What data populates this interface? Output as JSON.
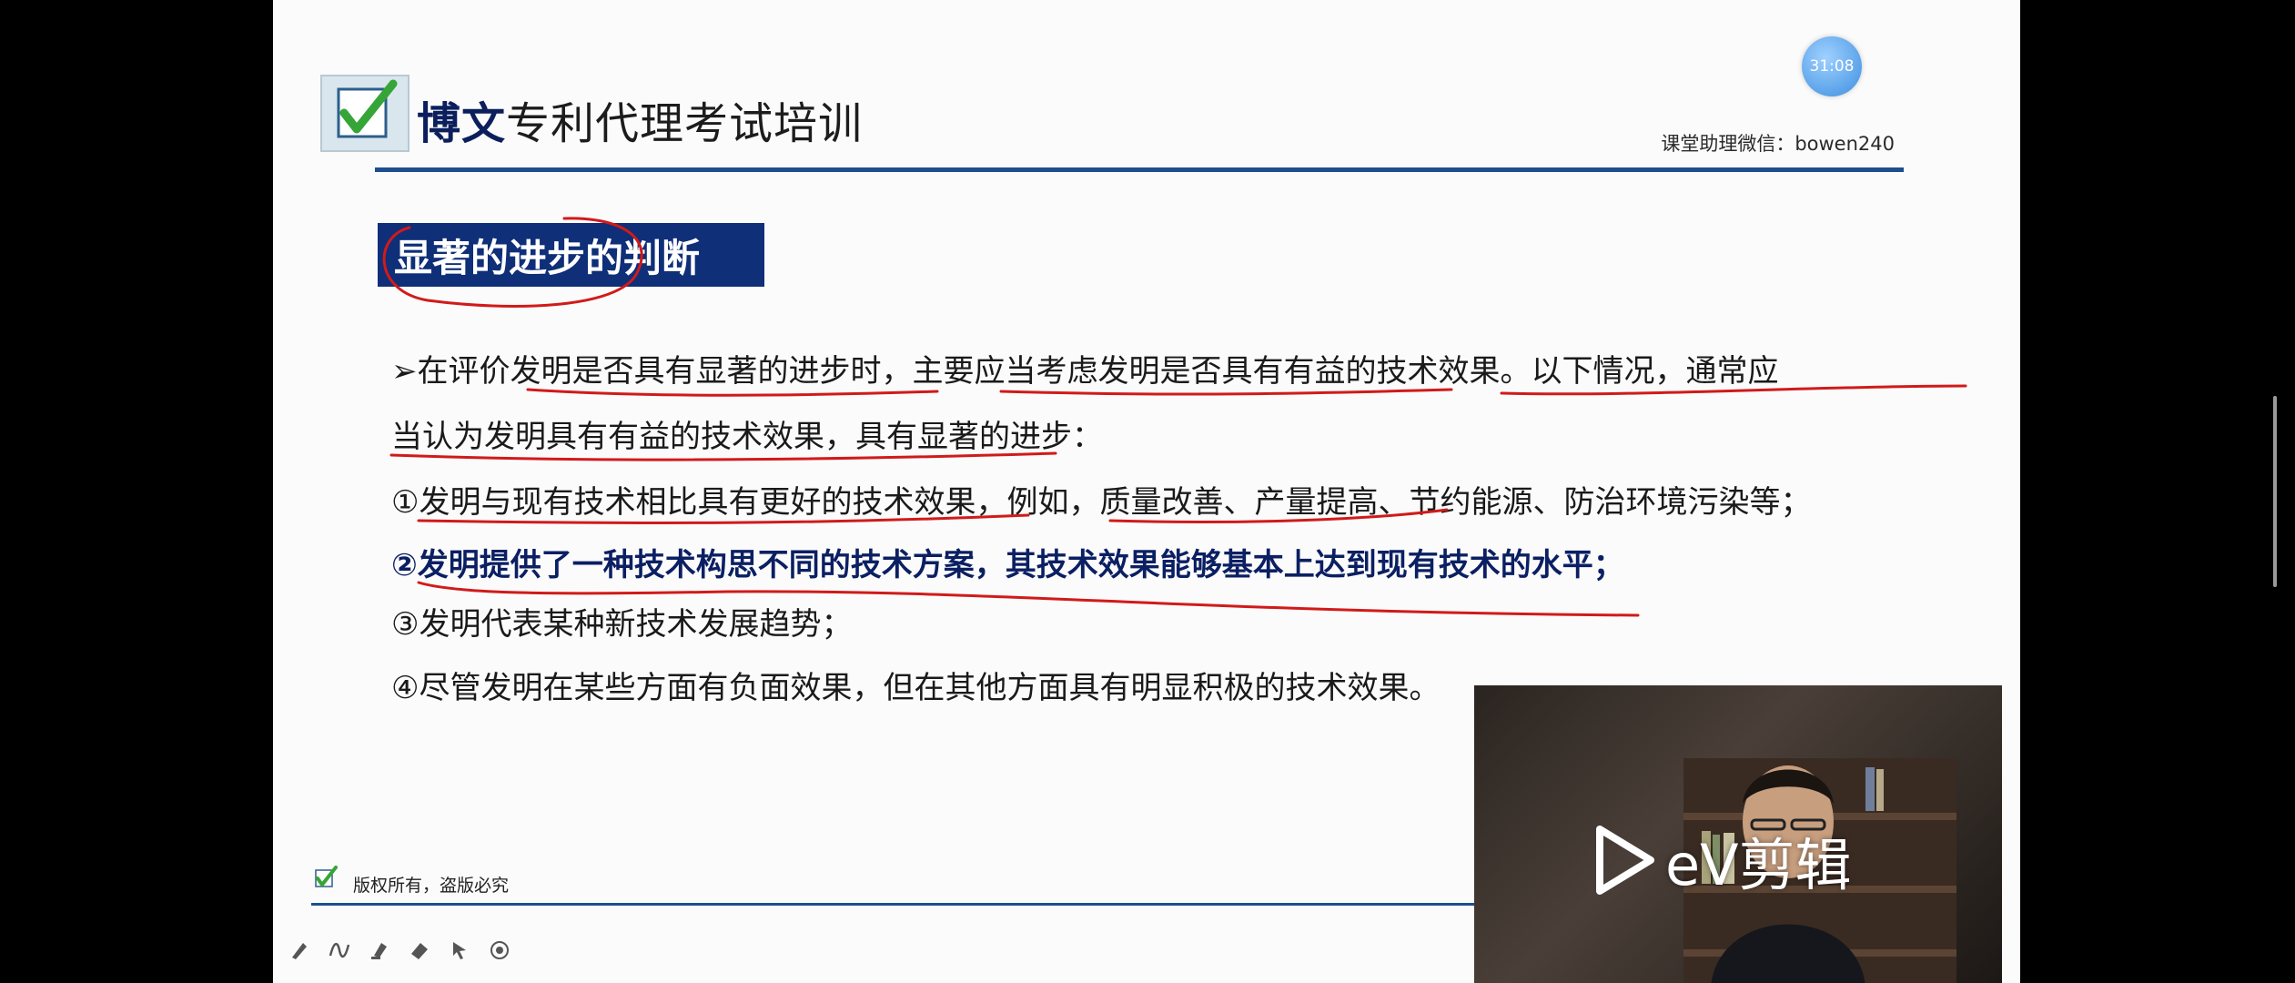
{
  "header": {
    "brand_bold": "博文",
    "brand_rest": "专利代理考试培训",
    "assistant_wechat": "课堂助理微信：bowen240"
  },
  "timer": {
    "text": "31:08"
  },
  "section": {
    "heading": "显著的进步的判断"
  },
  "content": {
    "lines": [
      "➢在评价发明是否具有显著的进步时，主要应当考虑发明是否具有有益的技术效果。以下情况，通常应",
      "当认为发明具有有益的技术效果，具有显著的进步：",
      "①发明与现有技术相比具有更好的技术效果，例如，质量改善、产量提高、节约能源、防治环境污染等；",
      "②发明提供了一种技术构思不同的技术方案，其技术效果能够基本上达到现有技术的水平；",
      "③发明代表某种新技术发展趋势；",
      "④尽管发明在某些方面有负面效果，但在其他方面具有明显积极的技术效果。"
    ]
  },
  "footer": {
    "copyright": "版权所有，盗版必究"
  },
  "toolbar": {
    "tools": [
      "pen-icon",
      "curve-icon",
      "highlighter-icon",
      "eraser-icon",
      "pointer-icon",
      "record-icon"
    ]
  },
  "watermark": {
    "text": "eV剪辑"
  },
  "colors": {
    "brand_navy": "#0f2f78",
    "rule_blue": "#1f4e8f",
    "annotation_red": "#d11a1a"
  }
}
